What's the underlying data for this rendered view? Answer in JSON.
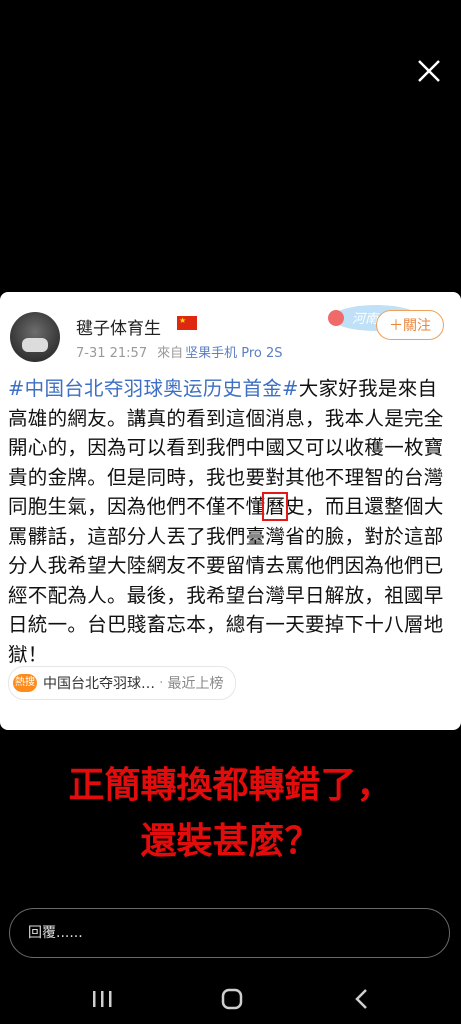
{
  "overlay": {
    "close_icon": "close-icon"
  },
  "post": {
    "username": "毽子体育生",
    "flag_icon": "china-flag-icon",
    "timestamp": "7-31 21:57",
    "source_prefix": "來自",
    "source_device": "坚果手机 Pro 2S",
    "badge_text": "河南",
    "follow_label": "＋關注",
    "hashtag": "#中国台北夺羽球奥运历史首金#",
    "body_before_box": "大家好我是來自高雄的網友。講真的看到這個消息，我本人是完全開心的，因為可以看到我們中國又可以收穫一枚寶貴的金牌。但是同時，我也要對其他不理智的台灣同胞生氣，因為他們不僅不懂",
    "body_boxed": "曆",
    "body_after_box": "史，而且還整個大罵髒話，這部分人丟了我們臺灣省的臉，對於這部分人我希望大陸網友不要留情去罵他們因為他們已經不配為人。最後，我希望台灣早日解放，祖國早日統一。台巴賤畜忘本，總有一天要掉下十八層地獄！",
    "hot_label": "熱搜",
    "hot_topic": "中国台北夺羽球…",
    "hot_sep": "·",
    "hot_status": "最近上榜"
  },
  "caption": {
    "line1": "正簡轉換都轉錯了，",
    "line2": "還裝甚麼？"
  },
  "reply": {
    "placeholder": "回覆......"
  },
  "nav": {
    "recents_icon": "recents-icon",
    "home_icon": "home-icon",
    "back_icon": "back-icon"
  },
  "colors": {
    "caption_red": "#e30c0c",
    "hashtag_blue": "#3d6fc4",
    "follow_orange": "#e8863c"
  }
}
